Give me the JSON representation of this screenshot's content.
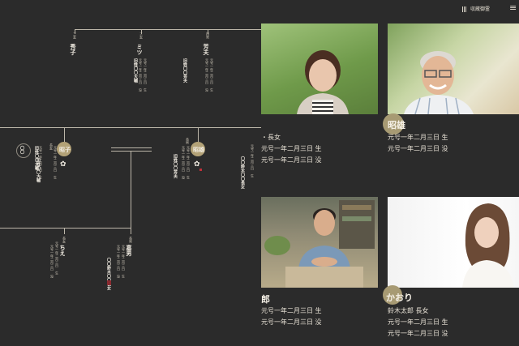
{
  "header": {
    "brand": "収蔵御霊",
    "menu_label": "≡"
  },
  "tree": {
    "top_row": [
      {
        "rel": "二女",
        "name": "秀子"
      },
      {
        "rel": "三女",
        "name": "ミツ",
        "born": "元号一年二月三日 生",
        "died": "元号一年二月三日 没",
        "note": "旧姓〇〇大輔"
      },
      {
        "rel": "四男",
        "name": "芳夫",
        "born": "元号一年二月三日 生",
        "died": "元号一年二月三日 没",
        "note": "旧姓〇〇芳夫"
      }
    ],
    "middle_row": [
      {
        "rel": "",
        "name": "〇〇",
        "born": "元号一年二月三日 生",
        "note": "旧姓〇〇大輔"
      },
      {
        "rel": "長女",
        "name": "昭子",
        "born": "元号一年二月三日 生",
        "note": "旧姓〇〇大輔"
      },
      {
        "rel": "長男",
        "name": "昭雄",
        "born": "元号一年二月三日 生",
        "died": "元号一年二月三日 没",
        "note": "旧姓〇〇芳夫"
      },
      {
        "rel": "",
        "name": "",
        "born": "元号一年二月三日 生",
        "note": "〇〇鈴木〇〇長女"
      }
    ],
    "bottom_row": [
      {
        "rel": "長女",
        "name": "ちえ",
        "born": "元号一年二月三日 生",
        "died": "元号一年二月三日 没"
      },
      {
        "rel": "長男",
        "name": "嘉男",
        "born": "元号一年二月三日 生",
        "died": "元号一年二月三日 没",
        "note": "〇〇鈴木〇〇長女"
      }
    ]
  },
  "cards": [
    {
      "id": "woman-elder",
      "name": "",
      "lines": [
        "・長女",
        "元号一年二月三日 生",
        "元号一年二月三日 没"
      ]
    },
    {
      "id": "man-elder",
      "name": "昭雄",
      "lines": [
        "元号一年二月三日 生",
        "元号一年二月三日 没"
      ]
    },
    {
      "id": "man-young",
      "name": "郎",
      "lines": [
        "元号一年二月三日 生",
        "元号一年二月三日 没"
      ]
    },
    {
      "id": "woman-young",
      "name": "かおり",
      "lines": [
        "鈴木太郎 長女",
        "元号一年二月三日 生",
        "元号一年二月三日 没"
      ]
    }
  ],
  "crest_glyph": "✿",
  "colors": {
    "background": "#2b2b2b",
    "gold": "#a79a73",
    "line": "#bdb7aa"
  }
}
